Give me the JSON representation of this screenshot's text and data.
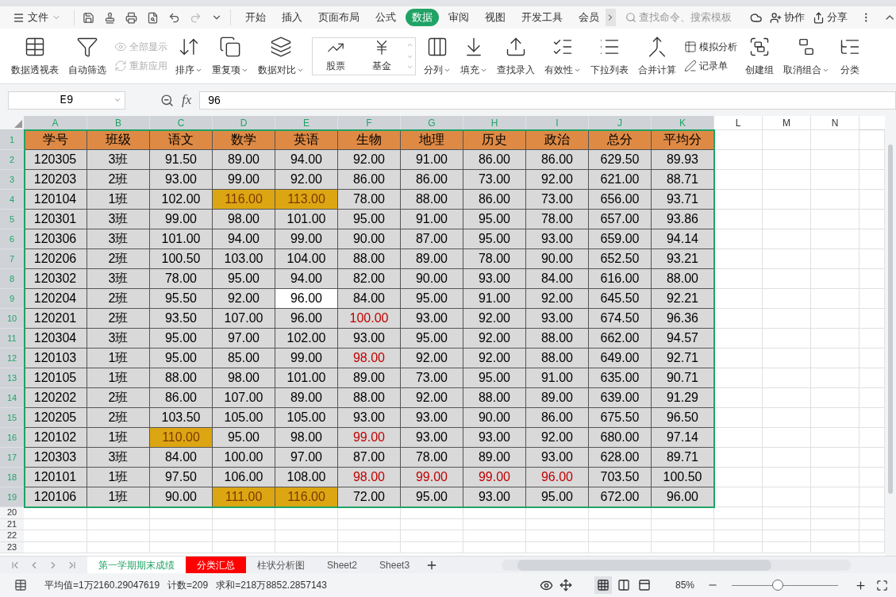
{
  "file_menu": "文件",
  "menu_tabs": [
    {
      "label": "开始",
      "selected": false
    },
    {
      "label": "插入",
      "selected": false
    },
    {
      "label": "页面布局",
      "selected": false
    },
    {
      "label": "公式",
      "selected": false
    },
    {
      "label": "数据",
      "selected": true
    },
    {
      "label": "审阅",
      "selected": false
    },
    {
      "label": "视图",
      "selected": false
    },
    {
      "label": "开发工具",
      "selected": false
    },
    {
      "label": "会员",
      "selected": false
    }
  ],
  "search": {
    "placeholder": "查找命令、搜索模板"
  },
  "actions": [
    "协作",
    "分享"
  ],
  "ribbon": [
    {
      "kind": "large",
      "label": "数据透视表",
      "dropdown": false
    },
    {
      "kind": "large",
      "label": "自动筛选",
      "dropdown": false
    },
    {
      "kind": "stack",
      "items": [
        {
          "label": "全部显示",
          "disabled": true
        },
        {
          "label": "重新应用",
          "disabled": true
        }
      ]
    },
    {
      "kind": "large",
      "label": "排序",
      "dropdown": true
    },
    {
      "kind": "large",
      "label": "重复项",
      "dropdown": true
    },
    {
      "kind": "large",
      "label": "数据对比",
      "dropdown": true
    },
    {
      "kind": "gallery",
      "items": [
        "股票",
        "基金"
      ]
    },
    {
      "kind": "large",
      "label": "分列",
      "dropdown": true
    },
    {
      "kind": "large",
      "label": "填充",
      "dropdown": true
    },
    {
      "kind": "large",
      "label": "查找录入",
      "dropdown": false
    },
    {
      "kind": "large",
      "label": "有效性",
      "dropdown": true
    },
    {
      "kind": "large",
      "label": "下拉列表",
      "dropdown": false
    },
    {
      "kind": "large",
      "label": "合并计算",
      "dropdown": false
    },
    {
      "kind": "stack",
      "items": [
        {
          "label": "模拟分析",
          "disabled": false
        },
        {
          "label": "记录单",
          "disabled": false
        }
      ]
    },
    {
      "kind": "large",
      "label": "创建组",
      "dropdown": false
    },
    {
      "kind": "large",
      "label": "取消组合",
      "dropdown": true
    },
    {
      "kind": "large",
      "label": "分类",
      "dropdown": false
    }
  ],
  "name_box": "E9",
  "formula_label": "fx",
  "formula": "96",
  "columns": [
    {
      "label": "A",
      "selected": true
    },
    {
      "label": "B",
      "selected": true
    },
    {
      "label": "C",
      "selected": true
    },
    {
      "label": "D",
      "selected": true
    },
    {
      "label": "E",
      "selected": true
    },
    {
      "label": "F",
      "selected": true
    },
    {
      "label": "G",
      "selected": true
    },
    {
      "label": "H",
      "selected": true
    },
    {
      "label": "I",
      "selected": true
    },
    {
      "label": "J",
      "selected": true
    },
    {
      "label": "K",
      "selected": true
    },
    {
      "label": "L",
      "selected": false
    },
    {
      "label": "M",
      "selected": false
    },
    {
      "label": "N",
      "selected": false
    }
  ],
  "header_row": [
    "学号",
    "班级",
    "语文",
    "数学",
    "英语",
    "生物",
    "地理",
    "历史",
    "政治",
    "总分",
    "平均分"
  ],
  "rows": [
    [
      "120305",
      "3班",
      "91.50",
      "89.00",
      "94.00",
      "92.00",
      "91.00",
      "86.00",
      "86.00",
      "629.50",
      "89.93"
    ],
    [
      "120203",
      "2班",
      "93.00",
      "99.00",
      "92.00",
      "86.00",
      "86.00",
      "73.00",
      "92.00",
      "621.00",
      "88.71"
    ],
    [
      "120104",
      "1班",
      "102.00",
      {
        "text": "116.00",
        "kind": "highlight"
      },
      {
        "text": "113.00",
        "kind": "highlight"
      },
      "78.00",
      "88.00",
      "86.00",
      "73.00",
      "656.00",
      "93.71"
    ],
    [
      "120301",
      "3班",
      "99.00",
      "98.00",
      "101.00",
      "95.00",
      "91.00",
      "95.00",
      "78.00",
      "657.00",
      "93.86"
    ],
    [
      "120306",
      "3班",
      "101.00",
      "94.00",
      "99.00",
      "90.00",
      "87.00",
      "95.00",
      "93.00",
      "659.00",
      "94.14"
    ],
    [
      "120206",
      "2班",
      "100.50",
      "103.00",
      "104.00",
      "88.00",
      "89.00",
      "78.00",
      "90.00",
      "652.50",
      "93.21"
    ],
    [
      "120302",
      "3班",
      "78.00",
      "95.00",
      "94.00",
      "82.00",
      "90.00",
      "93.00",
      "84.00",
      "616.00",
      "88.00"
    ],
    [
      "120204",
      "2班",
      "95.50",
      "92.00",
      {
        "text": "96.00",
        "kind": "active"
      },
      "84.00",
      "95.00",
      "91.00",
      "92.00",
      "645.50",
      "92.21"
    ],
    [
      "120201",
      "2班",
      "93.50",
      "107.00",
      "96.00",
      {
        "text": "100.00",
        "kind": "flagged"
      },
      "93.00",
      "92.00",
      "93.00",
      "674.50",
      "96.36"
    ],
    [
      "120304",
      "3班",
      "95.00",
      "97.00",
      "102.00",
      "93.00",
      "95.00",
      "92.00",
      "88.00",
      "662.00",
      "94.57"
    ],
    [
      "120103",
      "1班",
      "95.00",
      "85.00",
      "99.00",
      {
        "text": "98.00",
        "kind": "flagged"
      },
      "92.00",
      "92.00",
      "88.00",
      "649.00",
      "92.71"
    ],
    [
      "120105",
      "1班",
      "88.00",
      "98.00",
      "101.00",
      "89.00",
      "73.00",
      "95.00",
      "91.00",
      "635.00",
      "90.71"
    ],
    [
      "120202",
      "2班",
      "86.00",
      "107.00",
      "89.00",
      "88.00",
      "92.00",
      "88.00",
      "89.00",
      "639.00",
      "91.29"
    ],
    [
      "120205",
      "2班",
      "103.50",
      "105.00",
      "105.00",
      "93.00",
      "93.00",
      "90.00",
      "86.00",
      "675.50",
      "96.50"
    ],
    [
      "120102",
      "1班",
      {
        "text": "110.00",
        "kind": "highlight"
      },
      "95.00",
      "98.00",
      {
        "text": "99.00",
        "kind": "flagged"
      },
      "93.00",
      "93.00",
      "92.00",
      "680.00",
      "97.14"
    ],
    [
      "120303",
      "3班",
      "84.00",
      "100.00",
      "97.00",
      "87.00",
      "78.00",
      "89.00",
      "93.00",
      "628.00",
      "89.71"
    ],
    [
      "120101",
      "1班",
      "97.50",
      "106.00",
      "108.00",
      {
        "text": "98.00",
        "kind": "flagged"
      },
      {
        "text": "99.00",
        "kind": "flagged"
      },
      {
        "text": "99.00",
        "kind": "flagged"
      },
      {
        "text": "96.00",
        "kind": "flagged"
      },
      "703.50",
      "100.50"
    ],
    [
      "120106",
      "1班",
      "90.00",
      {
        "text": "111.00",
        "kind": "highlight"
      },
      {
        "text": "116.00",
        "kind": "highlight"
      },
      "72.00",
      "95.00",
      "93.00",
      "95.00",
      "672.00",
      "96.00"
    ]
  ],
  "row_numbers": [
    {
      "label": "1",
      "selected": true
    },
    {
      "label": "2",
      "selected": true
    },
    {
      "label": "3",
      "selected": true
    },
    {
      "label": "4",
      "selected": true
    },
    {
      "label": "5",
      "selected": true
    },
    {
      "label": "6",
      "selected": true
    },
    {
      "label": "7",
      "selected": true
    },
    {
      "label": "8",
      "selected": true
    },
    {
      "label": "9",
      "selected": true
    },
    {
      "label": "10",
      "selected": true
    },
    {
      "label": "11",
      "selected": true
    },
    {
      "label": "12",
      "selected": true
    },
    {
      "label": "13",
      "selected": true
    },
    {
      "label": "14",
      "selected": true
    },
    {
      "label": "15",
      "selected": true
    },
    {
      "label": "16",
      "selected": true
    },
    {
      "label": "17",
      "selected": true
    },
    {
      "label": "18",
      "selected": true
    },
    {
      "label": "19",
      "selected": true
    },
    {
      "label": "20",
      "selected": false
    },
    {
      "label": "21",
      "selected": false
    },
    {
      "label": "22",
      "selected": false
    },
    {
      "label": "23",
      "selected": false
    }
  ],
  "sheet_tabs": [
    {
      "label": "第一学期期末成绩",
      "selected": true
    },
    {
      "label": "分类汇总",
      "selected": false,
      "color": "#ff0000"
    },
    {
      "label": "柱状分析图",
      "selected": false
    },
    {
      "label": "Sheet2",
      "selected": false
    },
    {
      "label": "Sheet3",
      "selected": false
    }
  ],
  "status": [
    "平均值=1万2160.29047619",
    "计数=209",
    "求和=218万8852.2857143"
  ],
  "view_modes": [
    {
      "selected": true
    },
    {
      "selected": false
    },
    {
      "selected": false
    }
  ],
  "zoom": {
    "label": "85%",
    "level": 0.43
  }
}
